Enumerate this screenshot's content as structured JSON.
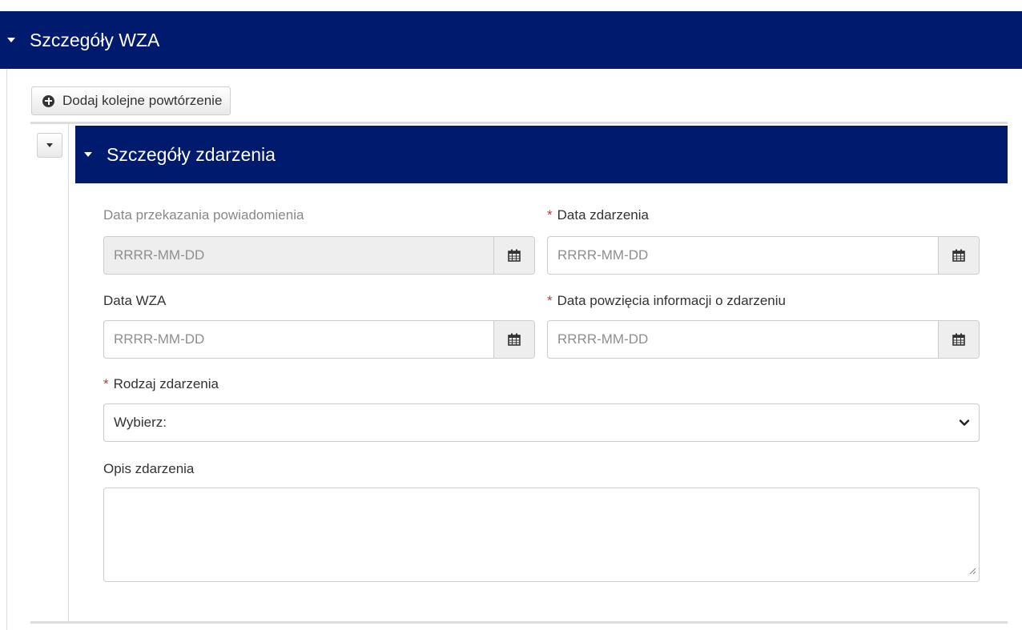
{
  "outer_section": {
    "title": "Szczegóły WZA"
  },
  "add_button": {
    "label": "Dodaj kolejne powtórzenie"
  },
  "inner_section": {
    "title": "Szczegóły zdarzenia"
  },
  "fields": {
    "data_przekazania": {
      "label": "Data przekazania powiadomienia",
      "placeholder": "RRRR-MM-DD",
      "required": false,
      "disabled": true
    },
    "data_zdarzenia": {
      "label": "Data zdarzenia",
      "placeholder": "RRRR-MM-DD",
      "required": true
    },
    "data_wza": {
      "label": "Data WZA",
      "placeholder": "RRRR-MM-DD",
      "required": false
    },
    "data_powziecia": {
      "label": "Data powzięcia informacji o zdarzeniu",
      "placeholder": "RRRR-MM-DD",
      "required": true
    },
    "rodzaj_zdarzenia": {
      "label": "Rodzaj zdarzenia",
      "selected": "Wybierz:",
      "required": true
    },
    "opis_zdarzenia": {
      "label": "Opis zdarzenia",
      "value": ""
    }
  },
  "required_marker": "*",
  "icons": {
    "collapse": "caret-down-icon",
    "add": "plus-circle-icon",
    "calendar": "calendar-icon",
    "select": "chevron-down-icon"
  },
  "colors": {
    "header_bg": "#001a6e",
    "required": "#a94442",
    "border": "#cccccc"
  }
}
